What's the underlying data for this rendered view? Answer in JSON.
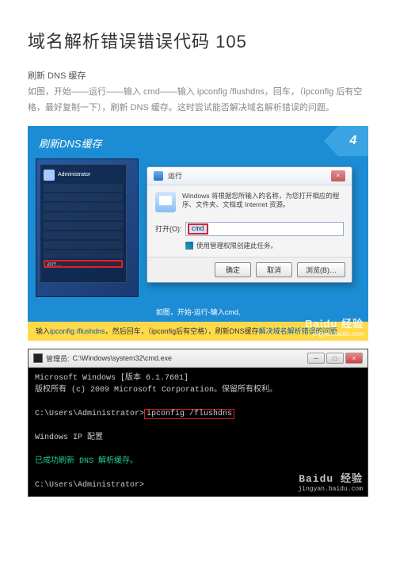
{
  "page": {
    "title": "域名解析错误错误代码 105",
    "intro_sub": "刷新 DNS 缓存",
    "intro_body": "如图，开始——运行——输入 cmd——输入 ipconfig   /flushdns，回车，（ipconfig 后有空格，最好复制一下），刷新 DNS 缓存。这时尝试能否解决域名解析错误的问题。"
  },
  "fig1": {
    "header": "刷新DNS缓存",
    "step": "4",
    "startmenu_user": "Administrator",
    "run_label": "运行…",
    "dialog": {
      "title": "运行",
      "desc": "Windows 将根据您所输入的名称，为您打开相应的程序、文件夹、文档或 Internet 资源。",
      "open_label": "打开(O):",
      "input_value": "cmd",
      "admin_note": "使用管理权限创建此任务。",
      "btn_ok": "确定",
      "btn_cancel": "取消",
      "btn_browse": "浏览(B)…",
      "close_x": "×"
    },
    "footer_top": "如图，开始-运行-输入cmd,",
    "footer_bot_a": "输入",
    "footer_bot_cmd": "ipconfig /flushdns",
    "footer_bot_b": "，然后回车，（ipconfig后有空格），刷新DNS缓存",
    "footer_bot_c": "解决域名解析错误的问题",
    "watermark_big": "Baidu 经验",
    "watermark_small": "jingyan.baidu.com"
  },
  "fig2": {
    "title_prefix": "管理员:",
    "title_path": "C:\\Windows\\system32\\cmd.exe",
    "min": "─",
    "max": "□",
    "close": "×",
    "line1": "Microsoft Windows [版本 6.1.7601]",
    "line2": "版权所有 (c) 2009 Microsoft Corporation。保留所有权利。",
    "prompt1": "C:\\Users\\Administrator>",
    "cmd": "ipconfig /flushdns",
    "line3": "Windows IP 配置",
    "line4": "已成功刷新 DNS 解析缓存。",
    "prompt2": "C:\\Users\\Administrator>",
    "watermark_big": "Baidu 经验",
    "watermark_small": "jingyan.baidu.com"
  }
}
